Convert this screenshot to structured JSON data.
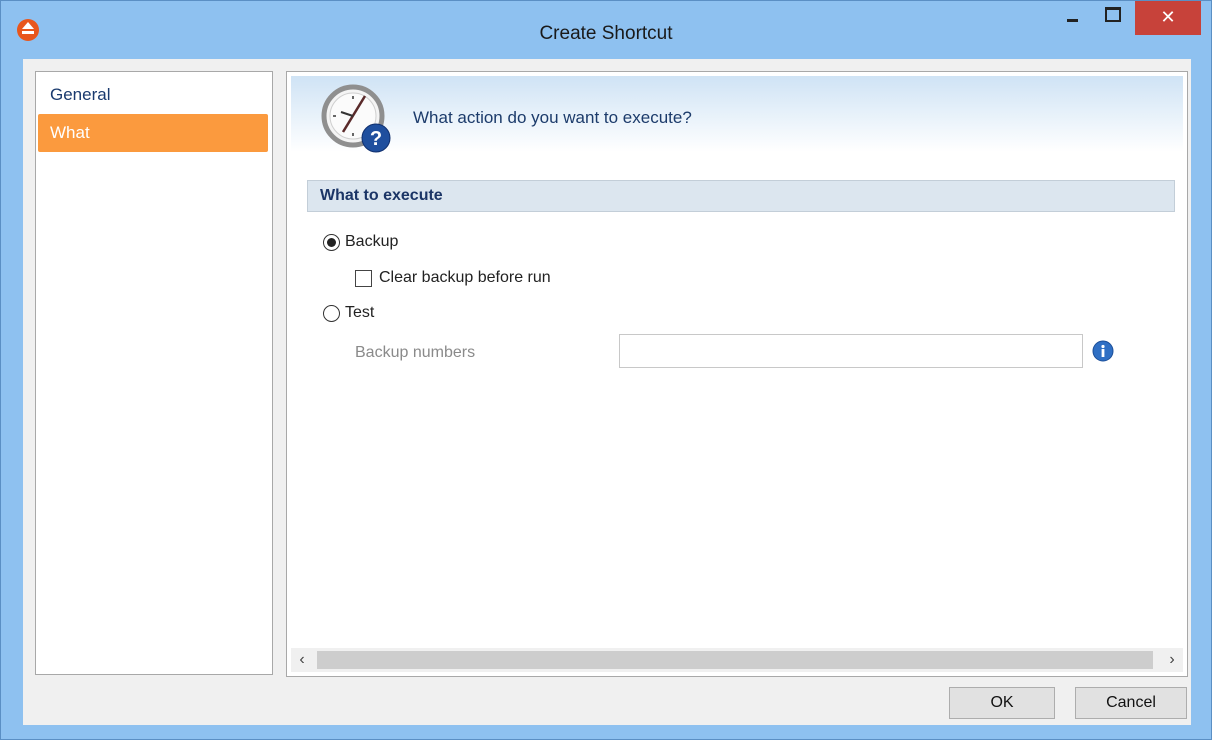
{
  "window": {
    "title": "Create Shortcut",
    "close_glyph": "✕",
    "controls": [
      "minimize-icon",
      "maximize-icon",
      "close-icon"
    ]
  },
  "sidebar": {
    "items": [
      {
        "label": "General",
        "selected": false
      },
      {
        "label": "What",
        "selected": true
      }
    ]
  },
  "banner": {
    "icon": "clock-question-icon",
    "text": "What action do you want to execute?"
  },
  "section": {
    "title": "What to execute",
    "options": {
      "backup": {
        "label": "Backup",
        "checked": true
      },
      "clear_backup": {
        "label": "Clear backup before run",
        "checked": false
      },
      "test": {
        "label": "Test",
        "checked": false
      }
    },
    "backup_numbers": {
      "label": "Backup numbers",
      "value": ""
    }
  },
  "scrollbar": {
    "left_glyph": "‹",
    "right_glyph": "›"
  },
  "buttons": {
    "ok": "OK",
    "cancel": "Cancel"
  },
  "colors": {
    "title_bar": "#8ec1f0",
    "close_button": "#c7423a",
    "selected_nav": "#fb9a3e",
    "section_header": "#dce6ef"
  }
}
